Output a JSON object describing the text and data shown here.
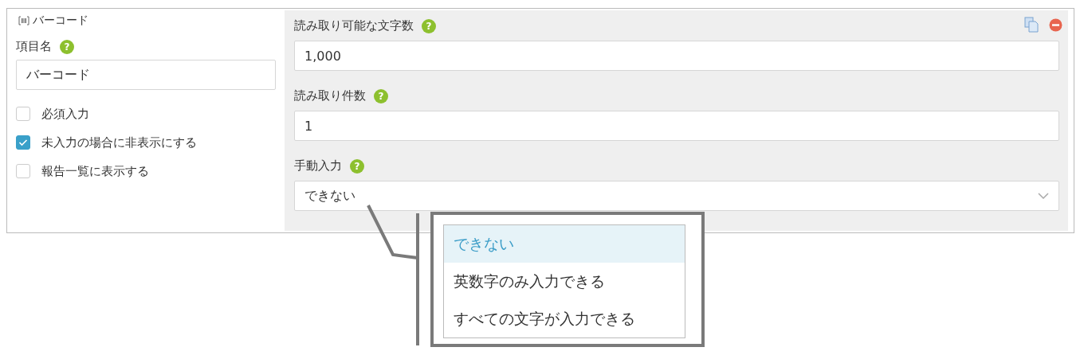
{
  "field_type": {
    "label": "バーコード"
  },
  "name_field": {
    "label": "項目名",
    "help": "?",
    "value": "バーコード"
  },
  "options": [
    {
      "label": "必須入力",
      "checked": false
    },
    {
      "label": "未入力の場合に非表示にする",
      "checked": true
    },
    {
      "label": "報告一覧に表示する",
      "checked": false
    }
  ],
  "settings": [
    {
      "kind": "text",
      "label": "読み取り可能な文字数",
      "help": "?",
      "value": "1,000"
    },
    {
      "kind": "text",
      "label": "読み取り件数",
      "help": "?",
      "value": "1"
    },
    {
      "kind": "select",
      "label": "手動入力",
      "help": "?",
      "value": "できない"
    }
  ],
  "dropdown_options": [
    {
      "label": "できない",
      "selected": true
    },
    {
      "label": "英数字のみ入力できる",
      "selected": false
    },
    {
      "label": "すべての文字が入力できる",
      "selected": false
    }
  ]
}
